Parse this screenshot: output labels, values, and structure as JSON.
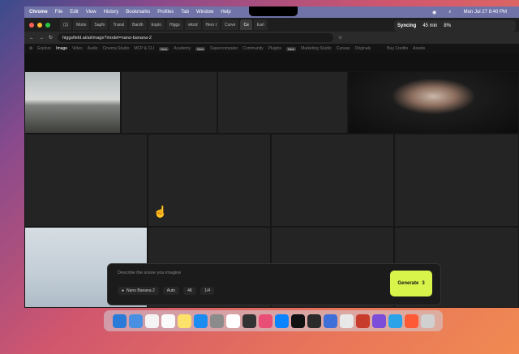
{
  "menubar": {
    "app": "Chrome",
    "items": [
      "File",
      "Edit",
      "View",
      "History",
      "Bookmarks",
      "Profiles",
      "Tab",
      "Window",
      "Help"
    ],
    "datetime": "Mon Jul 27 8:40 PM"
  },
  "browser": {
    "tabs": [
      "(1)",
      "Motio",
      "Sapfo",
      "Transl",
      "Bardh",
      "Explo",
      "Higgs",
      "vikod",
      "Hero t",
      "Curve",
      "Ce",
      "Earl"
    ],
    "active_tab": "Ce",
    "syncing": {
      "label": "Syncing",
      "time": "45 min",
      "percent": "8%"
    },
    "url": "higgsfield.ai/ai/image?model=nano-banana-2"
  },
  "site": {
    "nav": [
      "Explore",
      "Image",
      "Video",
      "Audio",
      "Cinema Studio",
      "MCP & CLI",
      "Academy",
      "Supercomputer",
      "Community",
      "Plugins",
      "Marketing Studio",
      "Canvas",
      "Originals"
    ],
    "active": "Image",
    "badge": "New",
    "buy": "Buy Credits",
    "assets": "Assets"
  },
  "panel": {
    "placeholder": "Describe the scene you imagine",
    "model": "Nano Banana 2",
    "auto": "Auto",
    "quality": "4K",
    "count": "1/4",
    "generate": "Generate",
    "credits": "3"
  }
}
